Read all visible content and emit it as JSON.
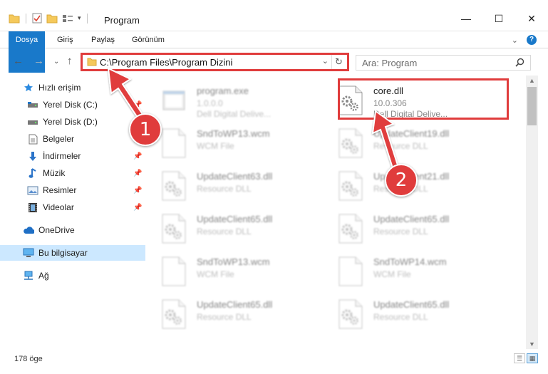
{
  "window": {
    "title": "Program",
    "minimize": "—",
    "maximize": "☐",
    "close": "✕"
  },
  "ribbon": {
    "tabs": [
      "Dosya",
      "Giriş",
      "Paylaş",
      "Görünüm"
    ],
    "expand": "⌄",
    "help": "?"
  },
  "address": {
    "path": "C:\\Program Files\\Program Dizini",
    "dropdown": "⌄",
    "refresh": "↻"
  },
  "nav": {
    "back": "←",
    "forward": "→",
    "recent": "⌄",
    "up": "↑"
  },
  "search": {
    "placeholder": "Ara: Program",
    "icon": "search-icon"
  },
  "sidebar": {
    "quick_access": "Hızlı erişim",
    "items": [
      {
        "label": "Yerel Disk (C:)",
        "icon": "drive-icon",
        "pinned": true
      },
      {
        "label": "Yerel Disk (D:)",
        "icon": "drive-icon",
        "pinned": false
      },
      {
        "label": "Belgeler",
        "icon": "documents-icon",
        "pinned": true
      },
      {
        "label": "İndirmeler",
        "icon": "download-icon",
        "pinned": true
      },
      {
        "label": "Müzik",
        "icon": "music-icon",
        "pinned": true
      },
      {
        "label": "Resimler",
        "icon": "pictures-icon",
        "pinned": true
      },
      {
        "label": "Videolar",
        "icon": "video-icon",
        "pinned": true
      }
    ],
    "onedrive": "OneDrive",
    "this_pc": "Bu bilgisayar",
    "network": "Ağ"
  },
  "files": [
    {
      "name": "program.exe",
      "meta1": "1.0.0.0",
      "meta2": "Dell Digital Delive...",
      "kind": "exe"
    },
    {
      "name": "core.dll",
      "meta1": "10.0.306",
      "meta2": "Dell Digital Delive...",
      "kind": "dll"
    },
    {
      "name": "SndToWP13.wcm",
      "meta1": "WCM File",
      "meta2": "",
      "kind": "blank"
    },
    {
      "name": "UpdateClient19.dll",
      "meta1": "Resource DLL",
      "meta2": "",
      "kind": "dll"
    },
    {
      "name": "UpdateClient63.dll",
      "meta1": "Resource DLL",
      "meta2": "",
      "kind": "dll"
    },
    {
      "name": "UpdateClient21.dll",
      "meta1": "Resource DLL",
      "meta2": "",
      "kind": "dll"
    },
    {
      "name": "UpdateClient65.dll",
      "meta1": "Resource DLL",
      "meta2": "",
      "kind": "dll"
    },
    {
      "name": "UpdateClient65.dll",
      "meta1": "Resource DLL",
      "meta2": "",
      "kind": "dll"
    },
    {
      "name": "SndToWP13.wcm",
      "meta1": "WCM File",
      "meta2": "",
      "kind": "blank"
    },
    {
      "name": "SndToWP14.wcm",
      "meta1": "WCM File",
      "meta2": "",
      "kind": "blank"
    },
    {
      "name": "UpdateClient65.dll",
      "meta1": "Resource DLL",
      "meta2": "",
      "kind": "dll"
    },
    {
      "name": "UpdateClient65.dll",
      "meta1": "Resource DLL",
      "meta2": "",
      "kind": "dll"
    }
  ],
  "status": {
    "count": "178 öge"
  },
  "annotations": [
    "1",
    "2"
  ],
  "colors": {
    "accent": "#1979ca",
    "annotation": "#e03c3c",
    "selected": "#cce8ff"
  }
}
